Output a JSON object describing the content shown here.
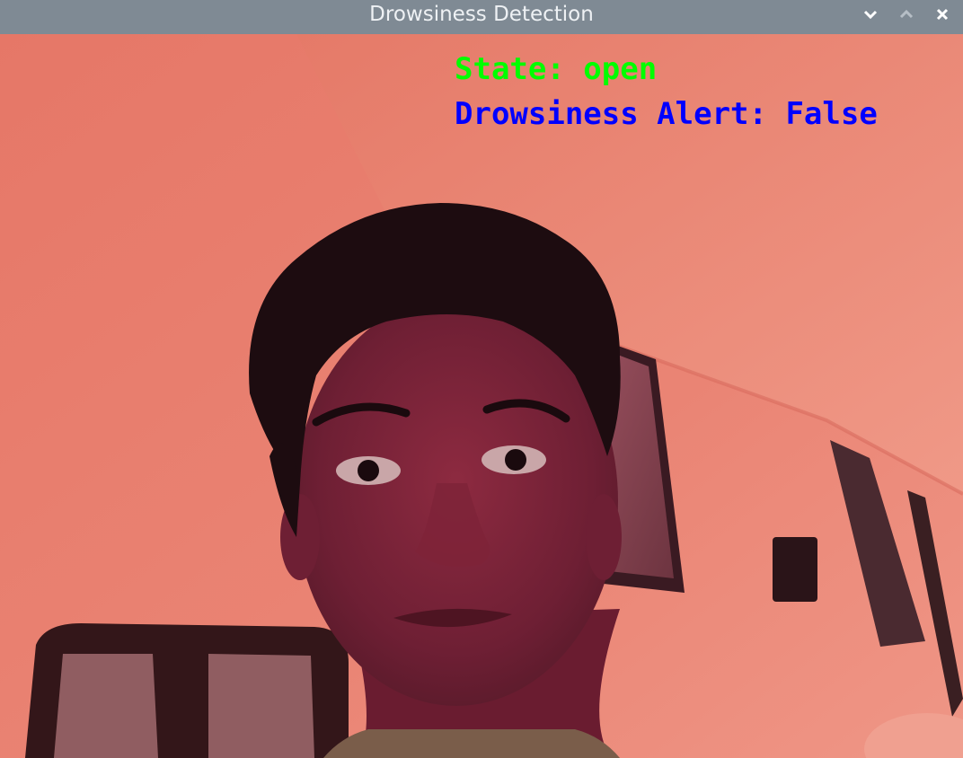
{
  "window": {
    "title": "Drowsiness Detection",
    "controls": {
      "minimize_icon": "chevron-down-icon",
      "maximize_icon": "chevron-up-icon",
      "close_icon": "close-icon"
    }
  },
  "overlay": {
    "state_text": "State: open",
    "alert_text": "Drowsiness Alert: False",
    "state_color": "#00ff00",
    "alert_color": "#0000ff"
  },
  "colors": {
    "titlebar": "#7f8a94",
    "wall": "#e87c6c"
  }
}
